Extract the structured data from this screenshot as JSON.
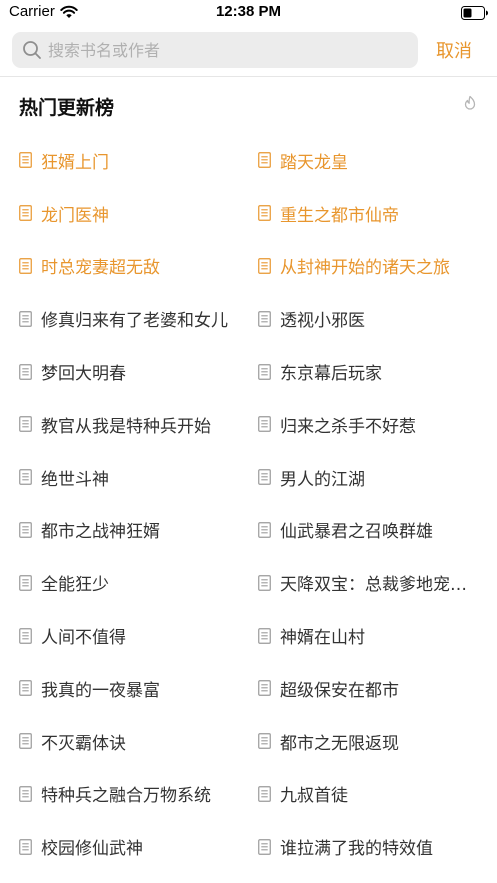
{
  "status_bar": {
    "carrier": "Carrier",
    "time": "12:38 PM"
  },
  "search": {
    "placeholder": "搜索书名或作者",
    "value": "",
    "cancel_label": "取消"
  },
  "section": {
    "title": "热门更新榜"
  },
  "colors": {
    "accent": "#e8962e",
    "text": "#333333",
    "icon_gray": "#9a9a9a"
  },
  "icons": {
    "wifi": "wifi-icon",
    "battery": "battery-icon",
    "search": "search-icon",
    "refresh": "refresh-icon",
    "item": "document-icon"
  },
  "books": [
    {
      "title": "狂婿上门",
      "hot": true
    },
    {
      "title": "踏天龙皇",
      "hot": true
    },
    {
      "title": "龙门医神",
      "hot": true
    },
    {
      "title": "重生之都市仙帝",
      "hot": true
    },
    {
      "title": "时总宠妻超无敌",
      "hot": true
    },
    {
      "title": "从封神开始的诸天之旅",
      "hot": true
    },
    {
      "title": "修真归来有了老婆和女儿",
      "hot": false
    },
    {
      "title": "透视小邪医",
      "hot": false
    },
    {
      "title": "梦回大明春",
      "hot": false
    },
    {
      "title": "东京幕后玩家",
      "hot": false
    },
    {
      "title": "教官从我是特种兵开始",
      "hot": false
    },
    {
      "title": "归来之杀手不好惹",
      "hot": false
    },
    {
      "title": "绝世斗神",
      "hot": false
    },
    {
      "title": "男人的江湖",
      "hot": false
    },
    {
      "title": "都市之战神狂婿",
      "hot": false
    },
    {
      "title": "仙武暴君之召唤群雄",
      "hot": false
    },
    {
      "title": "全能狂少",
      "hot": false
    },
    {
      "title": "天降双宝：总裁爹地宠上天",
      "hot": false
    },
    {
      "title": "人间不值得",
      "hot": false
    },
    {
      "title": "神婿在山村",
      "hot": false
    },
    {
      "title": "我真的一夜暴富",
      "hot": false
    },
    {
      "title": "超级保安在都市",
      "hot": false
    },
    {
      "title": "不灭霸体诀",
      "hot": false
    },
    {
      "title": "都市之无限返现",
      "hot": false
    },
    {
      "title": "特种兵之融合万物系统",
      "hot": false
    },
    {
      "title": "九叔首徒",
      "hot": false
    },
    {
      "title": "校园修仙武神",
      "hot": false
    },
    {
      "title": "谁拉满了我的特效值",
      "hot": false
    }
  ]
}
